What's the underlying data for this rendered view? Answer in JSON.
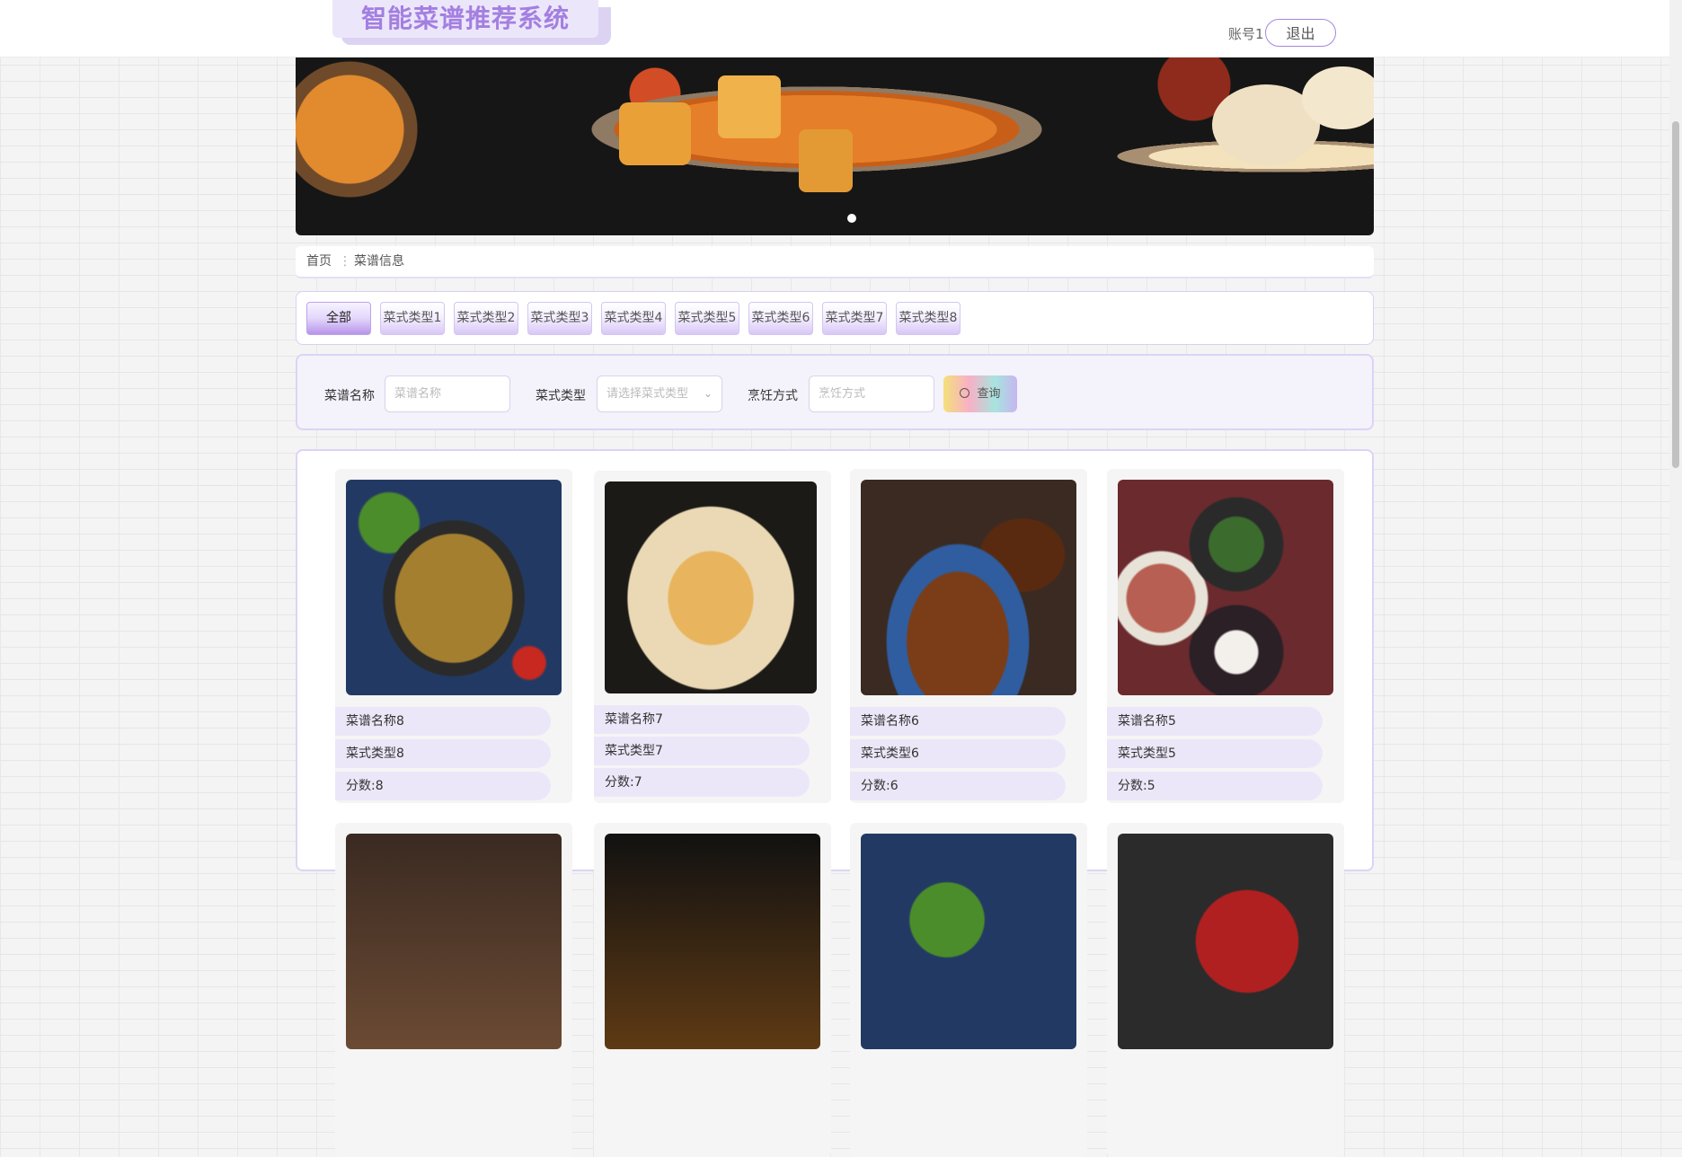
{
  "header": {
    "site_title": "智能菜谱推荐系统",
    "account_label": "账号1",
    "logout_label": "退出"
  },
  "breadcrumb": {
    "home": "首页",
    "separator": "⋮",
    "current": "菜谱信息"
  },
  "filter": {
    "items": [
      {
        "label": "全部",
        "active": true
      },
      {
        "label": "菜式类型1"
      },
      {
        "label": "菜式类型2"
      },
      {
        "label": "菜式类型3"
      },
      {
        "label": "菜式类型4"
      },
      {
        "label": "菜式类型5"
      },
      {
        "label": "菜式类型6"
      },
      {
        "label": "菜式类型7"
      },
      {
        "label": "菜式类型8"
      }
    ]
  },
  "search": {
    "name_label": "菜谱名称",
    "name_placeholder": "菜谱名称",
    "type_label": "菜式类型",
    "type_placeholder": "请选择菜式类型",
    "method_label": "烹饪方式",
    "method_placeholder": "烹饪方式",
    "query_label": "查询"
  },
  "recipes": [
    {
      "name": "菜谱名称8",
      "type": "菜式类型8",
      "score": "分数:8"
    },
    {
      "name": "菜谱名称7",
      "type": "菜式类型7",
      "score": "分数:7"
    },
    {
      "name": "菜谱名称6",
      "type": "菜式类型6",
      "score": "分数:6"
    },
    {
      "name": "菜谱名称5",
      "type": "菜式类型5",
      "score": "分数:5"
    }
  ],
  "colors": {
    "accent": "#a37fe0",
    "pill_background": "#ece7f8",
    "border": "#ddd3f5"
  },
  "icons": {
    "query": "search-icon",
    "select": "chevron-down-icon"
  }
}
